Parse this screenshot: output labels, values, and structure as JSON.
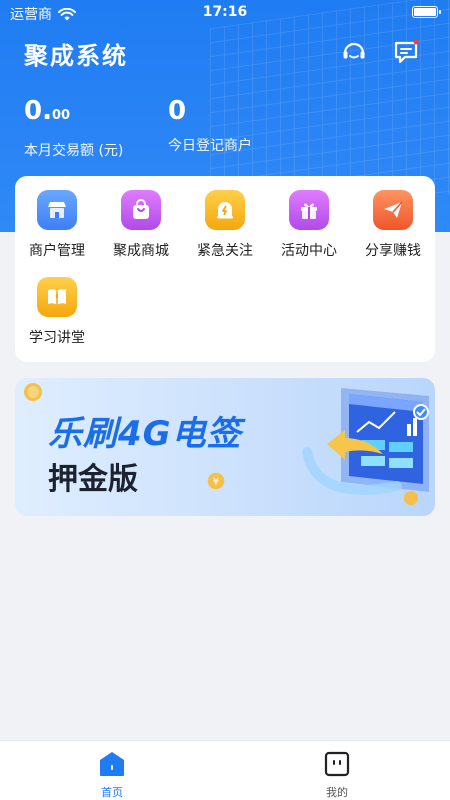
{
  "status_bar": {
    "carrier": "运营商",
    "time": "17:16"
  },
  "header": {
    "title": "聚成系统"
  },
  "stats": [
    {
      "value_main": "0.",
      "value_decimal": "00",
      "label": "本月交易额 (元)"
    },
    {
      "value_main": "0",
      "value_decimal": "",
      "label": "今日登记商户"
    }
  ],
  "menu": {
    "items": [
      {
        "label": "商户管理",
        "icon": "store-icon",
        "color": "#4f8ff7"
      },
      {
        "label": "聚成商城",
        "icon": "shopping-bag-icon",
        "color": "#c05cf0"
      },
      {
        "label": "紧急关注",
        "icon": "alert-bell-icon",
        "color": "#f6b418"
      },
      {
        "label": "活动中心",
        "icon": "gift-icon",
        "color": "#c05cf0"
      },
      {
        "label": "分享赚钱",
        "icon": "send-icon",
        "color": "#f56a3c"
      },
      {
        "label": "学习讲堂",
        "icon": "book-icon",
        "color": "#f6b418"
      }
    ]
  },
  "banner": {
    "title": "乐刷4G电签",
    "subtitle": "押金版"
  },
  "tabbar": {
    "home_label": "首页",
    "mine_label": "我的",
    "active_color": "#1f7cf2",
    "inactive_color": "#555555"
  }
}
